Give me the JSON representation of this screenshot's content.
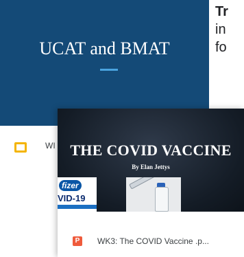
{
  "back_card": {
    "thumbnail_title": "UCAT and BMAT",
    "footer_label": "WI",
    "icon": "slides-icon",
    "colors": {
      "thumbnail_bg": "#144a77",
      "accent": "#4aa3df",
      "icon": "#f4b400"
    }
  },
  "side_text": {
    "line1": "Tr",
    "line2": "in",
    "line3": "fo"
  },
  "front_card": {
    "thumbnail_title": "THE COVID VACCINE",
    "author": "By Elan Jettys",
    "pfizer_logo": "fizer",
    "pfizer_text": "VID-19",
    "footer_label": "WK3: The COVID Vaccine .p...",
    "icon": "powerpoint-icon",
    "icon_letter": "P",
    "colors": {
      "icon": "#ef5b3c"
    }
  }
}
